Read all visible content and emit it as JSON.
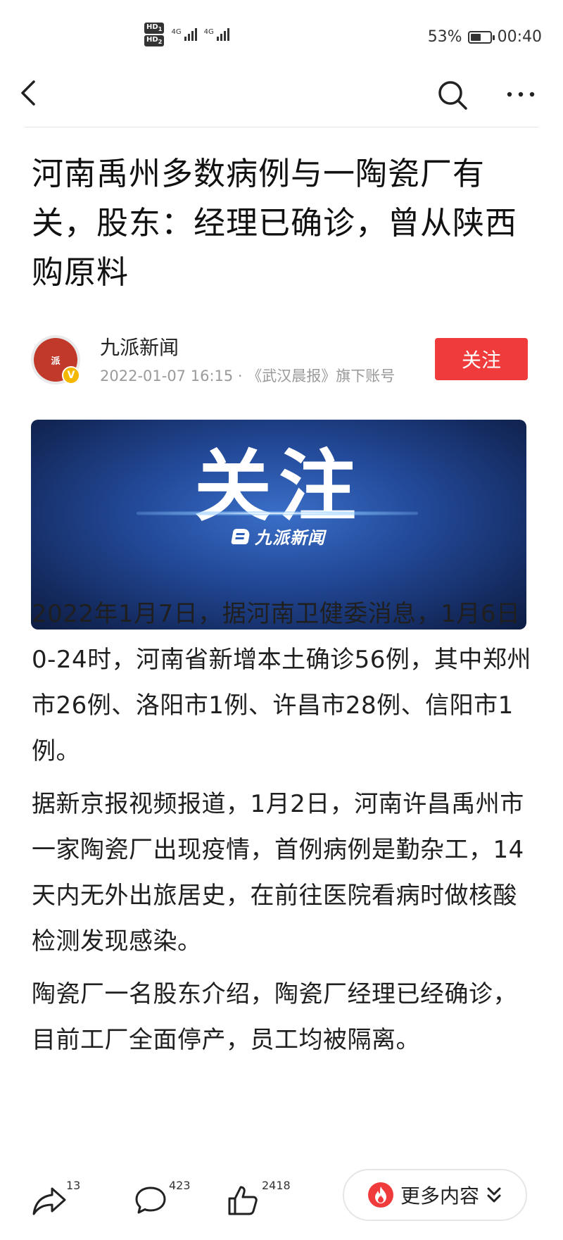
{
  "status_bar": {
    "sim1": "HD",
    "sim1_index": "1",
    "sim2": "HD",
    "sim2_index": "2",
    "network1": "4G",
    "network2": "4G",
    "battery_percent": "53%",
    "battery_level": 0.53,
    "time": "00:40"
  },
  "nav": {
    "back_icon": "chevron-left-icon",
    "search_icon": "search-icon",
    "more_icon": "more-horizontal-icon"
  },
  "article": {
    "title": "河南禹州多数病例与一陶瓷厂有关，股东：经理已确诊，曾从陕西购原料",
    "author": {
      "avatar_text": "派",
      "verified_mark": "V",
      "name": "九派新闻",
      "meta": "2022-01-07 16:15 · 《武汉晨报》旗下账号",
      "follow_label": "关注"
    },
    "banner": {
      "headline": "关注",
      "logo_text": "九派新闻"
    },
    "paragraphs": [
      "2022年1月7日，据河南卫健委消息，1月6日0-24时，河南省新增本土确诊56例，其中郑州市26例、洛阳市1例、许昌市28例、信阳市1例。",
      "据新京报视频报道，1月2日，河南许昌禹州市一家陶瓷厂出现疫情，首例病例是勤杂工，14天内无外出旅居史，在前往医院看病时做核酸检测发现感染。",
      "陶瓷厂一名股东介绍，陶瓷厂经理已经确诊，目前工厂全面停产，员工均被隔离。"
    ]
  },
  "bottom_bar": {
    "share_count": "13",
    "comment_count": "423",
    "like_count": "2418",
    "more_label": "更多内容",
    "accent_color": "#ef3b3b"
  }
}
